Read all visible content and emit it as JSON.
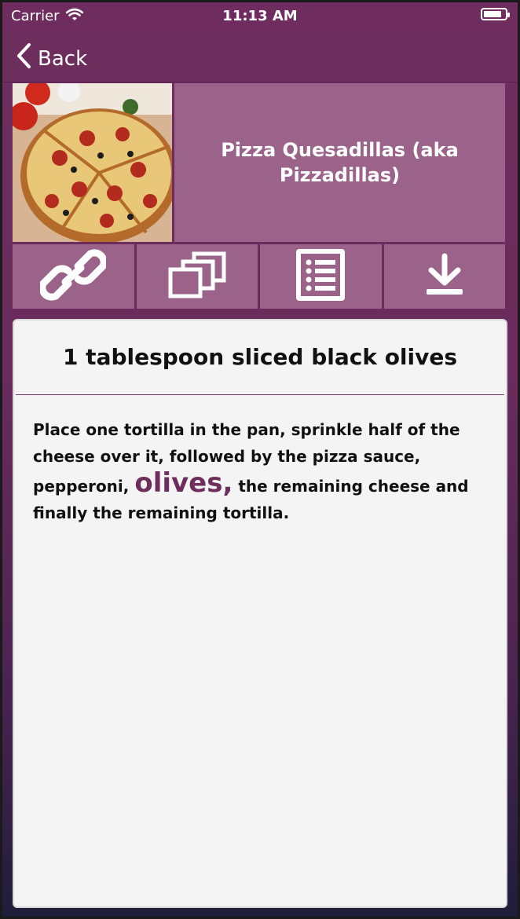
{
  "status_bar": {
    "carrier": "Carrier",
    "time": "11:13 AM"
  },
  "nav": {
    "back_label": "Back"
  },
  "recipe": {
    "title": "Pizza Quesadillas (aka Pizzadillas)"
  },
  "actions": [
    {
      "icon": "link-icon"
    },
    {
      "icon": "copy-icon"
    },
    {
      "icon": "list-icon"
    },
    {
      "icon": "download-icon"
    }
  ],
  "step": {
    "ingredient": "1 tablespoon sliced black olives",
    "text_before": "Place one tortilla in the pan, sprinkle half of the cheese over it, followed by the pizza sauce, pepperoni, ",
    "highlight": "olives,",
    "text_after": " the remaining cheese and finally the remaining tortilla."
  },
  "colors": {
    "accent": "#6d2e5d",
    "tile": "#9b6389",
    "card": "#f4f4f4"
  }
}
